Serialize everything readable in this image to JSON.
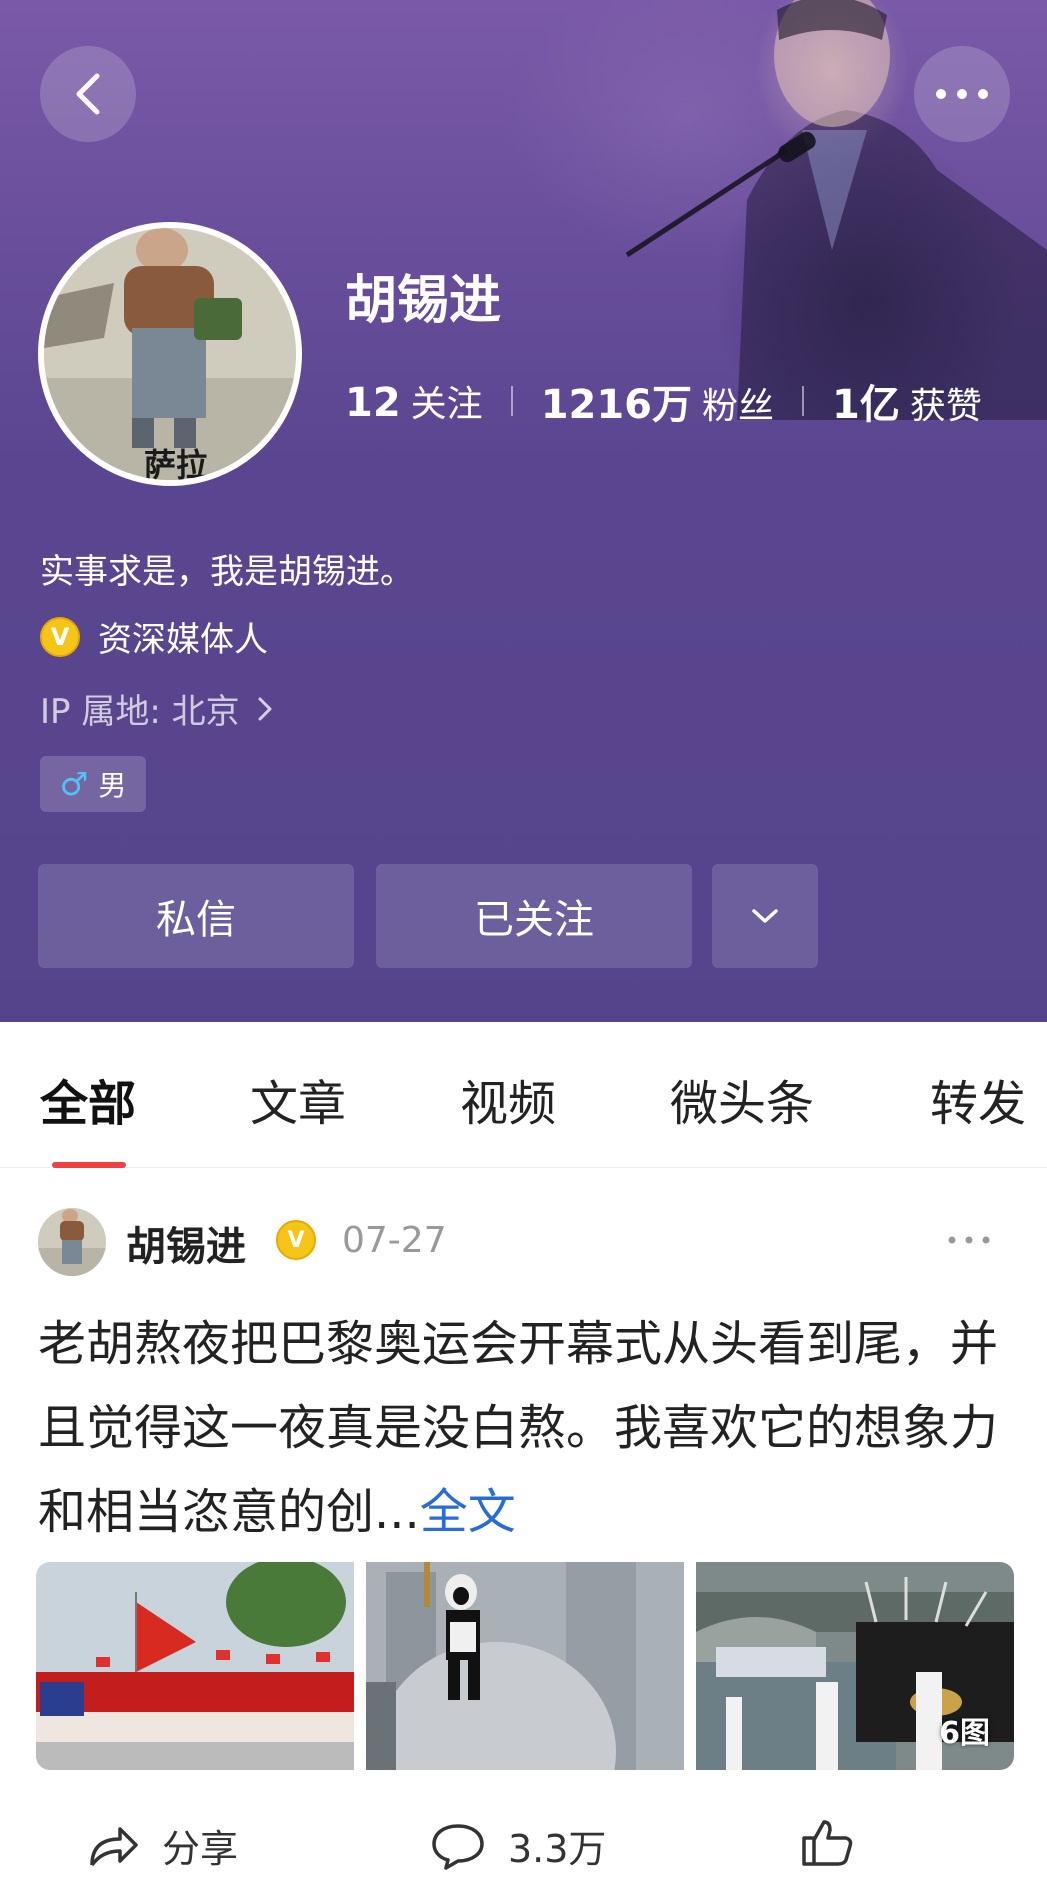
{
  "header": {
    "name": "胡锡进",
    "stats": [
      {
        "num": "12",
        "label": "关注"
      },
      {
        "num": "1216万",
        "label": "粉丝"
      },
      {
        "num": "1亿",
        "label": "获赞"
      }
    ],
    "bio": "实事求是，我是胡锡进。",
    "verification": "资深媒体人",
    "verify_badge": "V",
    "ip_location": "IP 属地: 北京",
    "gender_symbol": "♂",
    "gender": "男",
    "buttons": {
      "message": "私信",
      "follow": "已关注"
    },
    "avatar_caption": "萨拉",
    "accent_color": "#55448c"
  },
  "tabs": [
    "全部",
    "文章",
    "视频",
    "微头条",
    "转发"
  ],
  "post": {
    "author": "胡锡进",
    "verify_badge": "V",
    "date": "07-27",
    "text": "老胡熬夜把巴黎奥运会开幕式从头看到尾，并且觉得这一夜真是没白熬。我喜欢它的想象力和相当恣意的创...",
    "more_link": "全文",
    "image_count": "6图",
    "actions": {
      "share": "分享",
      "comments": "3.3万"
    }
  },
  "colors": {
    "tab_underline": "#f04142",
    "link": "#2a6cd6",
    "verify": "#f5c518"
  }
}
